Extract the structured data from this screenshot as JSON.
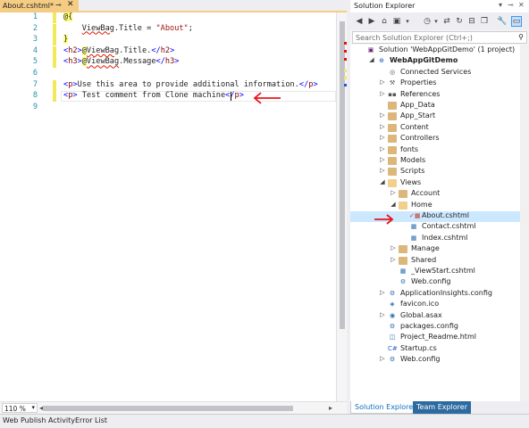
{
  "editor": {
    "tab": {
      "title": "About.cshtml*",
      "pin_glyph": "⊸",
      "close_glyph": "✕"
    },
    "lines": [
      {
        "num": "1",
        "parts": [
          {
            "t": "@{",
            "c": "razor"
          }
        ]
      },
      {
        "num": "2",
        "parts": [
          {
            "t": "    "
          },
          {
            "t": "ViewBag",
            "c": "squig"
          },
          {
            "t": ".Title = "
          },
          {
            "t": "\"About\"",
            "c": "str"
          },
          {
            "t": ";"
          }
        ]
      },
      {
        "num": "3",
        "parts": [
          {
            "t": "}",
            "c": "razor"
          }
        ]
      },
      {
        "num": "4",
        "parts": [
          {
            "t": "<",
            "c": "kw-tag"
          },
          {
            "t": "h2",
            "c": "kw-el"
          },
          {
            "t": ">",
            "c": "kw-tag"
          },
          {
            "t": "@",
            "c": "razor"
          },
          {
            "t": "ViewBag",
            "c": "squig"
          },
          {
            "t": ".Title."
          },
          {
            "t": "</",
            "c": "kw-tag"
          },
          {
            "t": "h2",
            "c": "kw-el"
          },
          {
            "t": ">",
            "c": "kw-tag"
          }
        ]
      },
      {
        "num": "5",
        "parts": [
          {
            "t": "<",
            "c": "kw-tag"
          },
          {
            "t": "h3",
            "c": "kw-el"
          },
          {
            "t": ">",
            "c": "kw-tag"
          },
          {
            "t": "@",
            "c": "razor"
          },
          {
            "t": "ViewBag",
            "c": "squig"
          },
          {
            "t": ".Message"
          },
          {
            "t": "</",
            "c": "kw-tag"
          },
          {
            "t": "h3",
            "c": "kw-el"
          },
          {
            "t": ">",
            "c": "kw-tag"
          }
        ]
      },
      {
        "num": "6",
        "parts": []
      },
      {
        "num": "7",
        "parts": [
          {
            "t": "<",
            "c": "kw-tag"
          },
          {
            "t": "p",
            "c": "kw-el"
          },
          {
            "t": ">",
            "c": "kw-tag"
          },
          {
            "t": "Use this area to provide additional information."
          },
          {
            "t": "</",
            "c": "kw-tag"
          },
          {
            "t": "p",
            "c": "kw-el"
          },
          {
            "t": ">",
            "c": "kw-tag"
          }
        ]
      },
      {
        "num": "8",
        "parts": [
          {
            "t": "<",
            "c": "kw-tag"
          },
          {
            "t": "p",
            "c": "kw-el"
          },
          {
            "t": ">",
            "c": "kw-tag"
          },
          {
            "t": " Test comment from Clone machine"
          },
          {
            "t": "</",
            "c": "kw-tag"
          },
          {
            "t": "p",
            "c": "kw-el"
          },
          {
            "t": ">",
            "c": "kw-tag"
          }
        ]
      },
      {
        "num": "9",
        "parts": []
      }
    ],
    "changed_lines": [
      "1",
      "2",
      "3",
      "4",
      "5",
      "7",
      "8"
    ],
    "zoom": "110 %"
  },
  "status": {
    "tabs": [
      "Web Publish Activity",
      "Error List"
    ]
  },
  "solution_explorer": {
    "title": "Solution Explorer",
    "search_placeholder": "Search Solution Explorer (Ctrl+;)",
    "tree": [
      {
        "label": "Solution 'WebAppGitDemo' (1 project)",
        "level": 0,
        "expander": "",
        "icon": "solution",
        "bold": false
      },
      {
        "label": "WebAppGitDemo",
        "level": 1,
        "expander": "◢",
        "icon": "project",
        "bold": true
      },
      {
        "label": "Connected Services",
        "level": 2,
        "expander": "",
        "icon": "services",
        "bold": false
      },
      {
        "label": "Properties",
        "level": 2,
        "expander": "▷",
        "icon": "properties",
        "bold": false
      },
      {
        "label": "References",
        "level": 2,
        "expander": "▷",
        "icon": "references",
        "bold": false
      },
      {
        "label": "App_Data",
        "level": 2,
        "expander": "",
        "icon": "folder",
        "bold": false
      },
      {
        "label": "App_Start",
        "level": 2,
        "expander": "▷",
        "icon": "folder",
        "bold": false
      },
      {
        "label": "Content",
        "level": 2,
        "expander": "▷",
        "icon": "folder",
        "bold": false
      },
      {
        "label": "Controllers",
        "level": 2,
        "expander": "▷",
        "icon": "folder",
        "bold": false
      },
      {
        "label": "fonts",
        "level": 2,
        "expander": "▷",
        "icon": "folder",
        "bold": false
      },
      {
        "label": "Models",
        "level": 2,
        "expander": "▷",
        "icon": "folder",
        "bold": false
      },
      {
        "label": "Scripts",
        "level": 2,
        "expander": "▷",
        "icon": "folder",
        "bold": false
      },
      {
        "label": "Views",
        "level": 2,
        "expander": "◢",
        "icon": "folder-open",
        "bold": false
      },
      {
        "label": "Account",
        "level": 3,
        "expander": "▷",
        "icon": "folder",
        "bold": false
      },
      {
        "label": "Home",
        "level": 3,
        "expander": "◢",
        "icon": "folder-open",
        "bold": false
      },
      {
        "label": "About.cshtml",
        "level": 4,
        "expander": "",
        "icon": "cshtml-edit",
        "bold": false,
        "selected": true
      },
      {
        "label": "Contact.cshtml",
        "level": 4,
        "expander": "",
        "icon": "cshtml",
        "bold": false
      },
      {
        "label": "Index.cshtml",
        "level": 4,
        "expander": "",
        "icon": "cshtml",
        "bold": false
      },
      {
        "label": "Manage",
        "level": 3,
        "expander": "▷",
        "icon": "folder",
        "bold": false
      },
      {
        "label": "Shared",
        "level": 3,
        "expander": "▷",
        "icon": "folder",
        "bold": false
      },
      {
        "label": "_ViewStart.cshtml",
        "level": 3,
        "expander": "",
        "icon": "cshtml",
        "bold": false
      },
      {
        "label": "Web.config",
        "level": 3,
        "expander": "",
        "icon": "config",
        "bold": false
      },
      {
        "label": "ApplicationInsights.config",
        "level": 2,
        "expander": "▷",
        "icon": "config",
        "bold": false
      },
      {
        "label": "favicon.ico",
        "level": 2,
        "expander": "",
        "icon": "ico",
        "bold": false
      },
      {
        "label": "Global.asax",
        "level": 2,
        "expander": "▷",
        "icon": "asax",
        "bold": false
      },
      {
        "label": "packages.config",
        "level": 2,
        "expander": "",
        "icon": "config",
        "bold": false
      },
      {
        "label": "Project_Readme.html",
        "level": 2,
        "expander": "",
        "icon": "html",
        "bold": false
      },
      {
        "label": "Startup.cs",
        "level": 2,
        "expander": "",
        "icon": "cs",
        "bold": false
      },
      {
        "label": "Web.config",
        "level": 2,
        "expander": "▷",
        "icon": "config",
        "bold": false
      }
    ],
    "tabs": [
      "Solution Explorer",
      "Team Explorer"
    ]
  },
  "colors": {
    "annotation": "#e8141c",
    "tab_active": "#f5cc84",
    "selection": "#cce8ff",
    "vs_blue": "#2d6aa0"
  }
}
